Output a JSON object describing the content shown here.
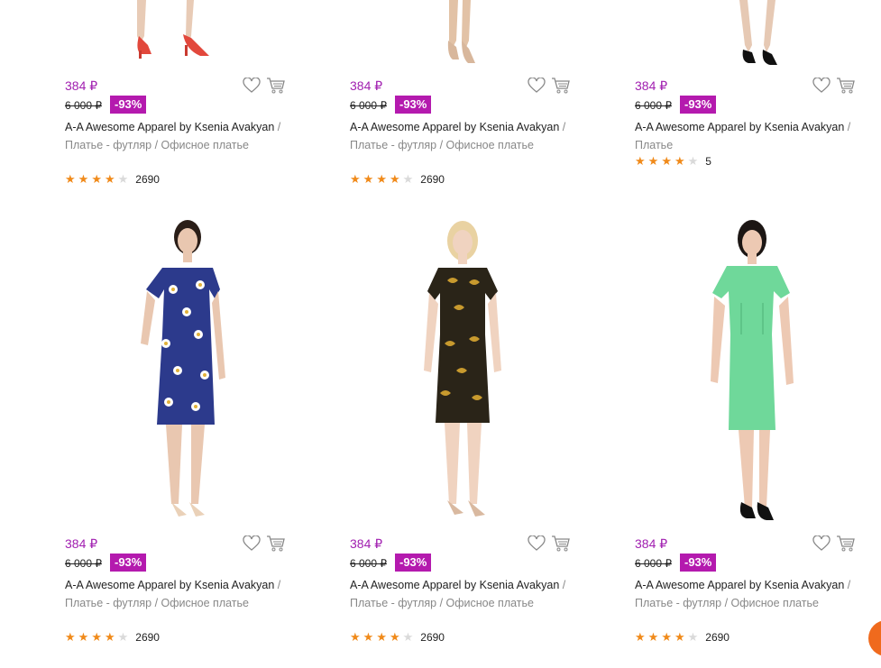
{
  "products": [
    {
      "price": "384 ₽",
      "old_price": "6 000 ₽",
      "discount": "-93%",
      "brand": "A-A Awesome Apparel by Ksenia Avakyan",
      "categories": "Платье - футляр / Офисное платье",
      "rating": 4,
      "reviews": "2690"
    },
    {
      "price": "384 ₽",
      "old_price": "6 000 ₽",
      "discount": "-93%",
      "brand": "A-A Awesome Apparel by Ksenia Avakyan",
      "categories": "Платье - футляр / Офисное платье",
      "rating": 4,
      "reviews": "2690"
    },
    {
      "price": "384 ₽",
      "old_price": "6 000 ₽",
      "discount": "-93%",
      "brand": "A-A Awesome Apparel by Ksenia Avakyan",
      "categories": "Платье",
      "rating": 4,
      "reviews": "5"
    },
    {
      "price": "384 ₽",
      "old_price": "6 000 ₽",
      "discount": "-93%",
      "brand": "A-A Awesome Apparel by Ksenia Avakyan",
      "categories": "Платье - футляр / Офисное платье",
      "rating": 4,
      "reviews": "2690",
      "dress_color": "#2c3a8c",
      "dress_pattern": "daisy"
    },
    {
      "price": "384 ₽",
      "old_price": "6 000 ₽",
      "discount": "-93%",
      "brand": "A-A Awesome Apparel by Ksenia Avakyan",
      "categories": "Платье - футляр / Офисное платье",
      "rating": 4,
      "reviews": "2690",
      "dress_color": "#2a2418",
      "dress_pattern": "floral-gold"
    },
    {
      "price": "384 ₽",
      "old_price": "6 000 ₽",
      "discount": "-93%",
      "brand": "A-A Awesome Apparel by Ksenia Avakyan",
      "categories": "Платье - футляр / Офисное платье",
      "rating": 4,
      "reviews": "2690",
      "dress_color": "#6fd89a",
      "dress_pattern": "solid"
    }
  ],
  "colors": {
    "price": "#a11fb0",
    "badge": "#b41aae",
    "star_on": "#f08a1a",
    "star_off": "#dadada",
    "chat": "#f06a1d"
  },
  "icons": {
    "wishlist": "heart-icon",
    "cart": "cart-icon",
    "chat": "chat-icon"
  }
}
